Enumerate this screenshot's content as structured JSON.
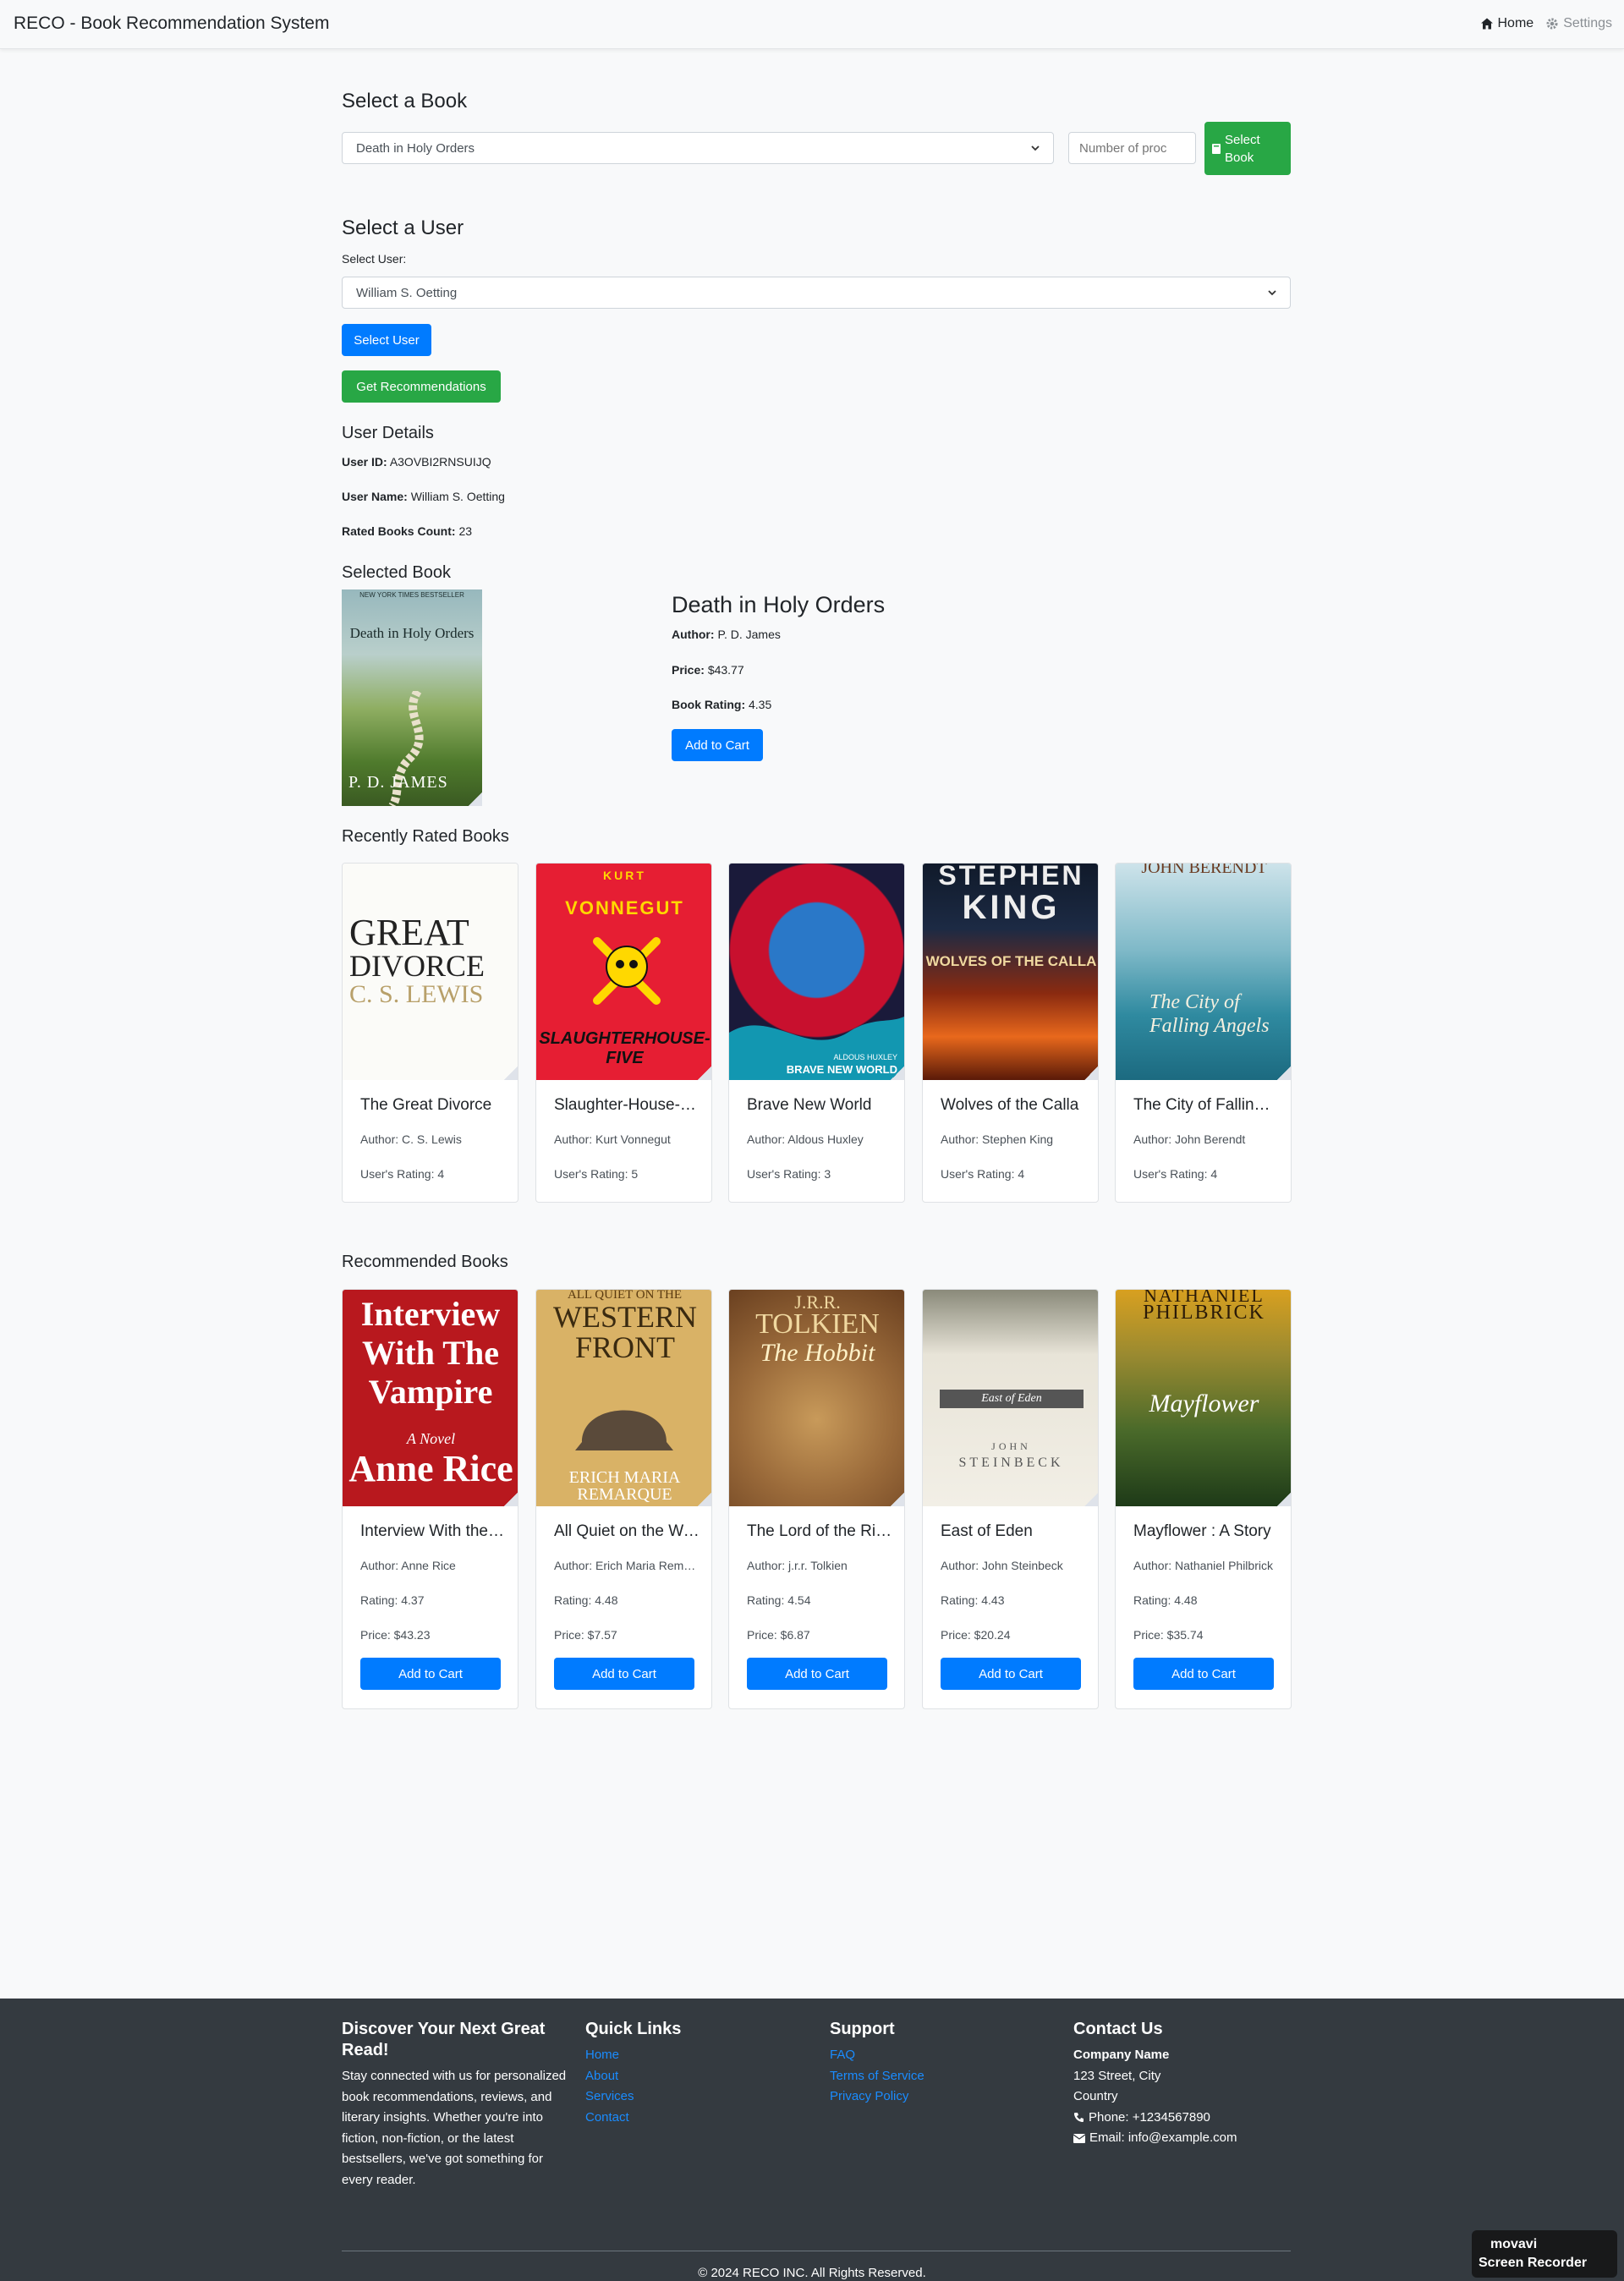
{
  "navbar": {
    "brand": "RECO - Book Recommendation System",
    "home": "Home",
    "settings": "Settings"
  },
  "select_book": {
    "heading": "Select a Book",
    "selected_value": "Death in Holy Orders",
    "count_placeholder": "Number of proc",
    "button": "Select Book"
  },
  "select_user": {
    "heading": "Select a User",
    "label": "Select User:",
    "selected_value": "William S. Oetting",
    "select_button": "Select User",
    "recommend_button": "Get Recommendations"
  },
  "user_details": {
    "heading": "User Details",
    "id_label": "User ID:",
    "id_value": "A3OVBI2RNSUIJQ",
    "name_label": "User Name:",
    "name_value": "William S. Oetting",
    "count_label": "Rated Books Count:",
    "count_value": "23"
  },
  "selected_book": {
    "heading": "Selected Book",
    "title": "Death in Holy Orders",
    "author_label": "Author:",
    "author": "P. D. James",
    "price_label": "Price:",
    "price": "$43.77",
    "rating_label": "Book Rating:",
    "rating": "4.35",
    "button": "Add to Cart",
    "cover_text": {
      "banner": "NEW YORK TIMES BESTSELLER",
      "title": "Death in Holy Orders",
      "author": "P. D. JAMES"
    }
  },
  "recently_rated": {
    "heading": "Recently Rated Books",
    "books": [
      {
        "title": "The Great Divorce",
        "author": "Author: C. S. Lewis",
        "rating": "User's Rating: 4",
        "cover": {
          "top": "GREAT",
          "mid": "DIVORCE",
          "bottom": "C. S. LEWIS"
        }
      },
      {
        "title": "Slaughter-House-Five",
        "author": "Author: Kurt Vonnegut",
        "rating": "User's Rating: 5",
        "cover": {
          "top": "KURT",
          "mid": "VONNEGUT",
          "bottom": "SLAUGHTERHOUSE-FIVE"
        }
      },
      {
        "title": "Brave New World",
        "author": "Author: Aldous Huxley",
        "rating": "User's Rating: 3",
        "cover": {
          "top": "ALDOUS HUXLEY",
          "mid": "",
          "bottom": "BRAVE NEW WORLD"
        }
      },
      {
        "title": "Wolves of the Calla",
        "author": "Author: Stephen King",
        "rating": "User's Rating: 4",
        "cover": {
          "top": "STEPHEN",
          "mid": "KING",
          "bottom": "WOLVES OF THE CALLA"
        }
      },
      {
        "title": "The City of Falling Angels",
        "author": "Author: John Berendt",
        "rating": "User's Rating: 4",
        "cover": {
          "top": "JOHN BERENDT",
          "mid": "",
          "bottom": "The City of Falling Angels"
        }
      }
    ]
  },
  "recommended": {
    "heading": "Recommended Books",
    "button": "Add to Cart",
    "books": [
      {
        "title": "Interview With the Vampire",
        "author": "Author: Anne Rice",
        "rating": "Rating: 4.37",
        "price": "Price: $43.23",
        "cover": {
          "top": "Interview With The Vampire",
          "mid": "A Novel",
          "bottom": "Anne Rice"
        }
      },
      {
        "title": "All Quiet on the Western Front",
        "author": "Author: Erich Maria Remarque",
        "rating": "Rating: 4.48",
        "price": "Price: $7.57",
        "cover": {
          "top": "ALL QUIET ON THE",
          "mid": "WESTERN FRONT",
          "bottom": "ERICH MARIA REMARQUE"
        }
      },
      {
        "title": "The Lord of the Rings",
        "author": "Author: j.r.r. Tolkien",
        "rating": "Rating: 4.54",
        "price": "Price: $6.87",
        "cover": {
          "top": "J.R.R.",
          "mid": "TOLKIEN",
          "bottom": "The Hobbit"
        }
      },
      {
        "title": "East of Eden",
        "author": "Author: John Steinbeck",
        "rating": "Rating: 4.43",
        "price": "Price: $20.24",
        "cover": {
          "top": "East of Eden",
          "mid": "JOHN",
          "bottom": "STEINBECK"
        }
      },
      {
        "title": "Mayflower : A Story",
        "author": "Author: Nathaniel Philbrick",
        "rating": "Rating: 4.48",
        "price": "Price: $35.74",
        "cover": {
          "top": "NATHANIEL",
          "mid": "PHILBRICK",
          "bottom": "Mayflower"
        }
      }
    ]
  },
  "footer": {
    "about_heading": "Discover Your Next Great Read!",
    "about_text": "Stay connected with us for personalized book recommendations, reviews, and literary insights. Whether you're into fiction, non-fiction, or the latest bestsellers, we've got something for every reader.",
    "quick_heading": "Quick Links",
    "quick_links": [
      "Home",
      "About",
      "Services",
      "Contact"
    ],
    "support_heading": "Support",
    "support_links": [
      "FAQ",
      "Terms of Service",
      "Privacy Policy"
    ],
    "contact_heading": "Contact Us",
    "company": "Company Name",
    "address1": "123 Street, City",
    "address2": "Country",
    "phone": "Phone: +1234567890",
    "email": "Email: info@example.com",
    "copyright": "© 2024 RECO INC. All Rights Reserved."
  },
  "watermark": {
    "line1": "movavi",
    "line2": "Screen Recorder"
  },
  "colors": {
    "green": "#28a745",
    "blue": "#007bff",
    "footer_bg": "#343a40",
    "link": "#1a8cff"
  }
}
